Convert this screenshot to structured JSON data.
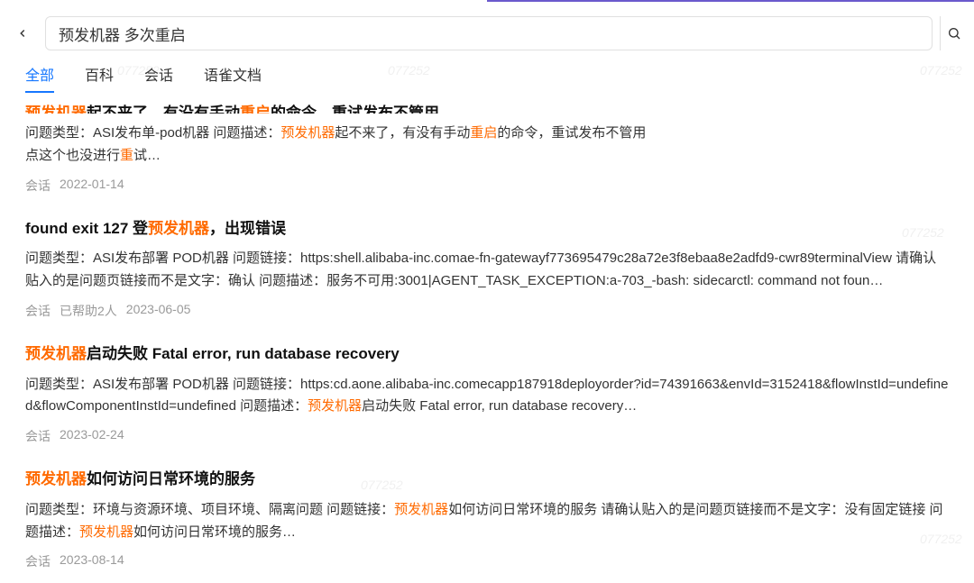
{
  "search": {
    "query": "预发机器 多次重启"
  },
  "tabs": {
    "all": "全部",
    "wiki": "百科",
    "session": "会话",
    "yuque": "语雀文档"
  },
  "watermark": "077252",
  "results": [
    {
      "title_segments": [
        {
          "text": "预发机器",
          "hl": true
        },
        {
          "text": "起不来了，有没有手动",
          "hl": false
        },
        {
          "text": "重启",
          "hl": true
        },
        {
          "text": "的命令，重试发布不管用",
          "hl": false
        }
      ],
      "desc_segments": [
        {
          "text": "问题类型：ASI发布单-pod机器 问题描述：",
          "hl": false
        },
        {
          "text": "预发机器",
          "hl": true
        },
        {
          "text": "起不来了，有没有手动",
          "hl": false
        },
        {
          "text": "重启",
          "hl": true
        },
        {
          "text": "的命令，重试发布不管用\n点这个也没进行",
          "hl": false
        },
        {
          "text": "重",
          "hl": true
        },
        {
          "text": "试…",
          "hl": false
        }
      ],
      "type": "会话",
      "help_count": "",
      "date": "2022-01-14"
    },
    {
      "title_segments": [
        {
          "text": "found exit 127 登",
          "hl": false
        },
        {
          "text": "预发机器",
          "hl": true
        },
        {
          "text": "，出现错误",
          "hl": false
        }
      ],
      "desc_segments": [
        {
          "text": "问题类型：ASI发布部署 POD机器 问题链接：https:shell.alibaba-inc.comae-fn-gatewayf773695479c28a72e3f8ebaa8e2adfd9-cwr89terminalView 请确认贴入的是问题页链接而不是文字：确认 问题描述：服务不可用:3001|AGENT_TASK_EXCEPTION:a-703_-bash: sidecarctl: command not foun…",
          "hl": false
        }
      ],
      "type": "会话",
      "help_count": "已帮助2人",
      "date": "2023-06-05"
    },
    {
      "title_segments": [
        {
          "text": "预发机器",
          "hl": true
        },
        {
          "text": "启动失败 Fatal error, run database recovery",
          "hl": false
        }
      ],
      "desc_segments": [
        {
          "text": "问题类型：ASI发布部署 POD机器 问题链接：https:cd.aone.alibaba-inc.comecapp187918deployorder?id=74391663&envId=3152418&flowInstId=undefined&flowComponentInstId=undefined 问题描述：",
          "hl": false
        },
        {
          "text": "预发机器",
          "hl": true
        },
        {
          "text": "启动失败 Fatal error, run database recovery…",
          "hl": false
        }
      ],
      "type": "会话",
      "help_count": "",
      "date": "2023-02-24"
    },
    {
      "title_segments": [
        {
          "text": "预发机器",
          "hl": true
        },
        {
          "text": "如何访问日常环境的服务",
          "hl": false
        }
      ],
      "desc_segments": [
        {
          "text": "问题类型：环境与资源环境、项目环境、隔离问题 问题链接：",
          "hl": false
        },
        {
          "text": "预发机器",
          "hl": true
        },
        {
          "text": "如何访问日常环境的服务 请确认贴入的是问题页链接而不是文字：没有固定链接 问题描述：",
          "hl": false
        },
        {
          "text": "预发机器",
          "hl": true
        },
        {
          "text": "如何访问日常环境的服务…",
          "hl": false
        }
      ],
      "type": "会话",
      "help_count": "",
      "date": "2023-08-14"
    }
  ]
}
